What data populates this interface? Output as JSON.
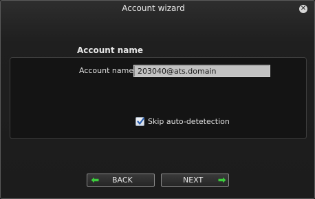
{
  "window": {
    "title": "Account wizard",
    "close_icon": "close-icon"
  },
  "section": {
    "heading": "Account name"
  },
  "form": {
    "account_label": "Account name",
    "account_value": "203040@ats.domain",
    "skip_label": "Skip auto-detetection",
    "skip_checked": true
  },
  "footer": {
    "back_label": "BACK",
    "next_label": "NEXT",
    "arrow_color": "#3ccc3c"
  }
}
